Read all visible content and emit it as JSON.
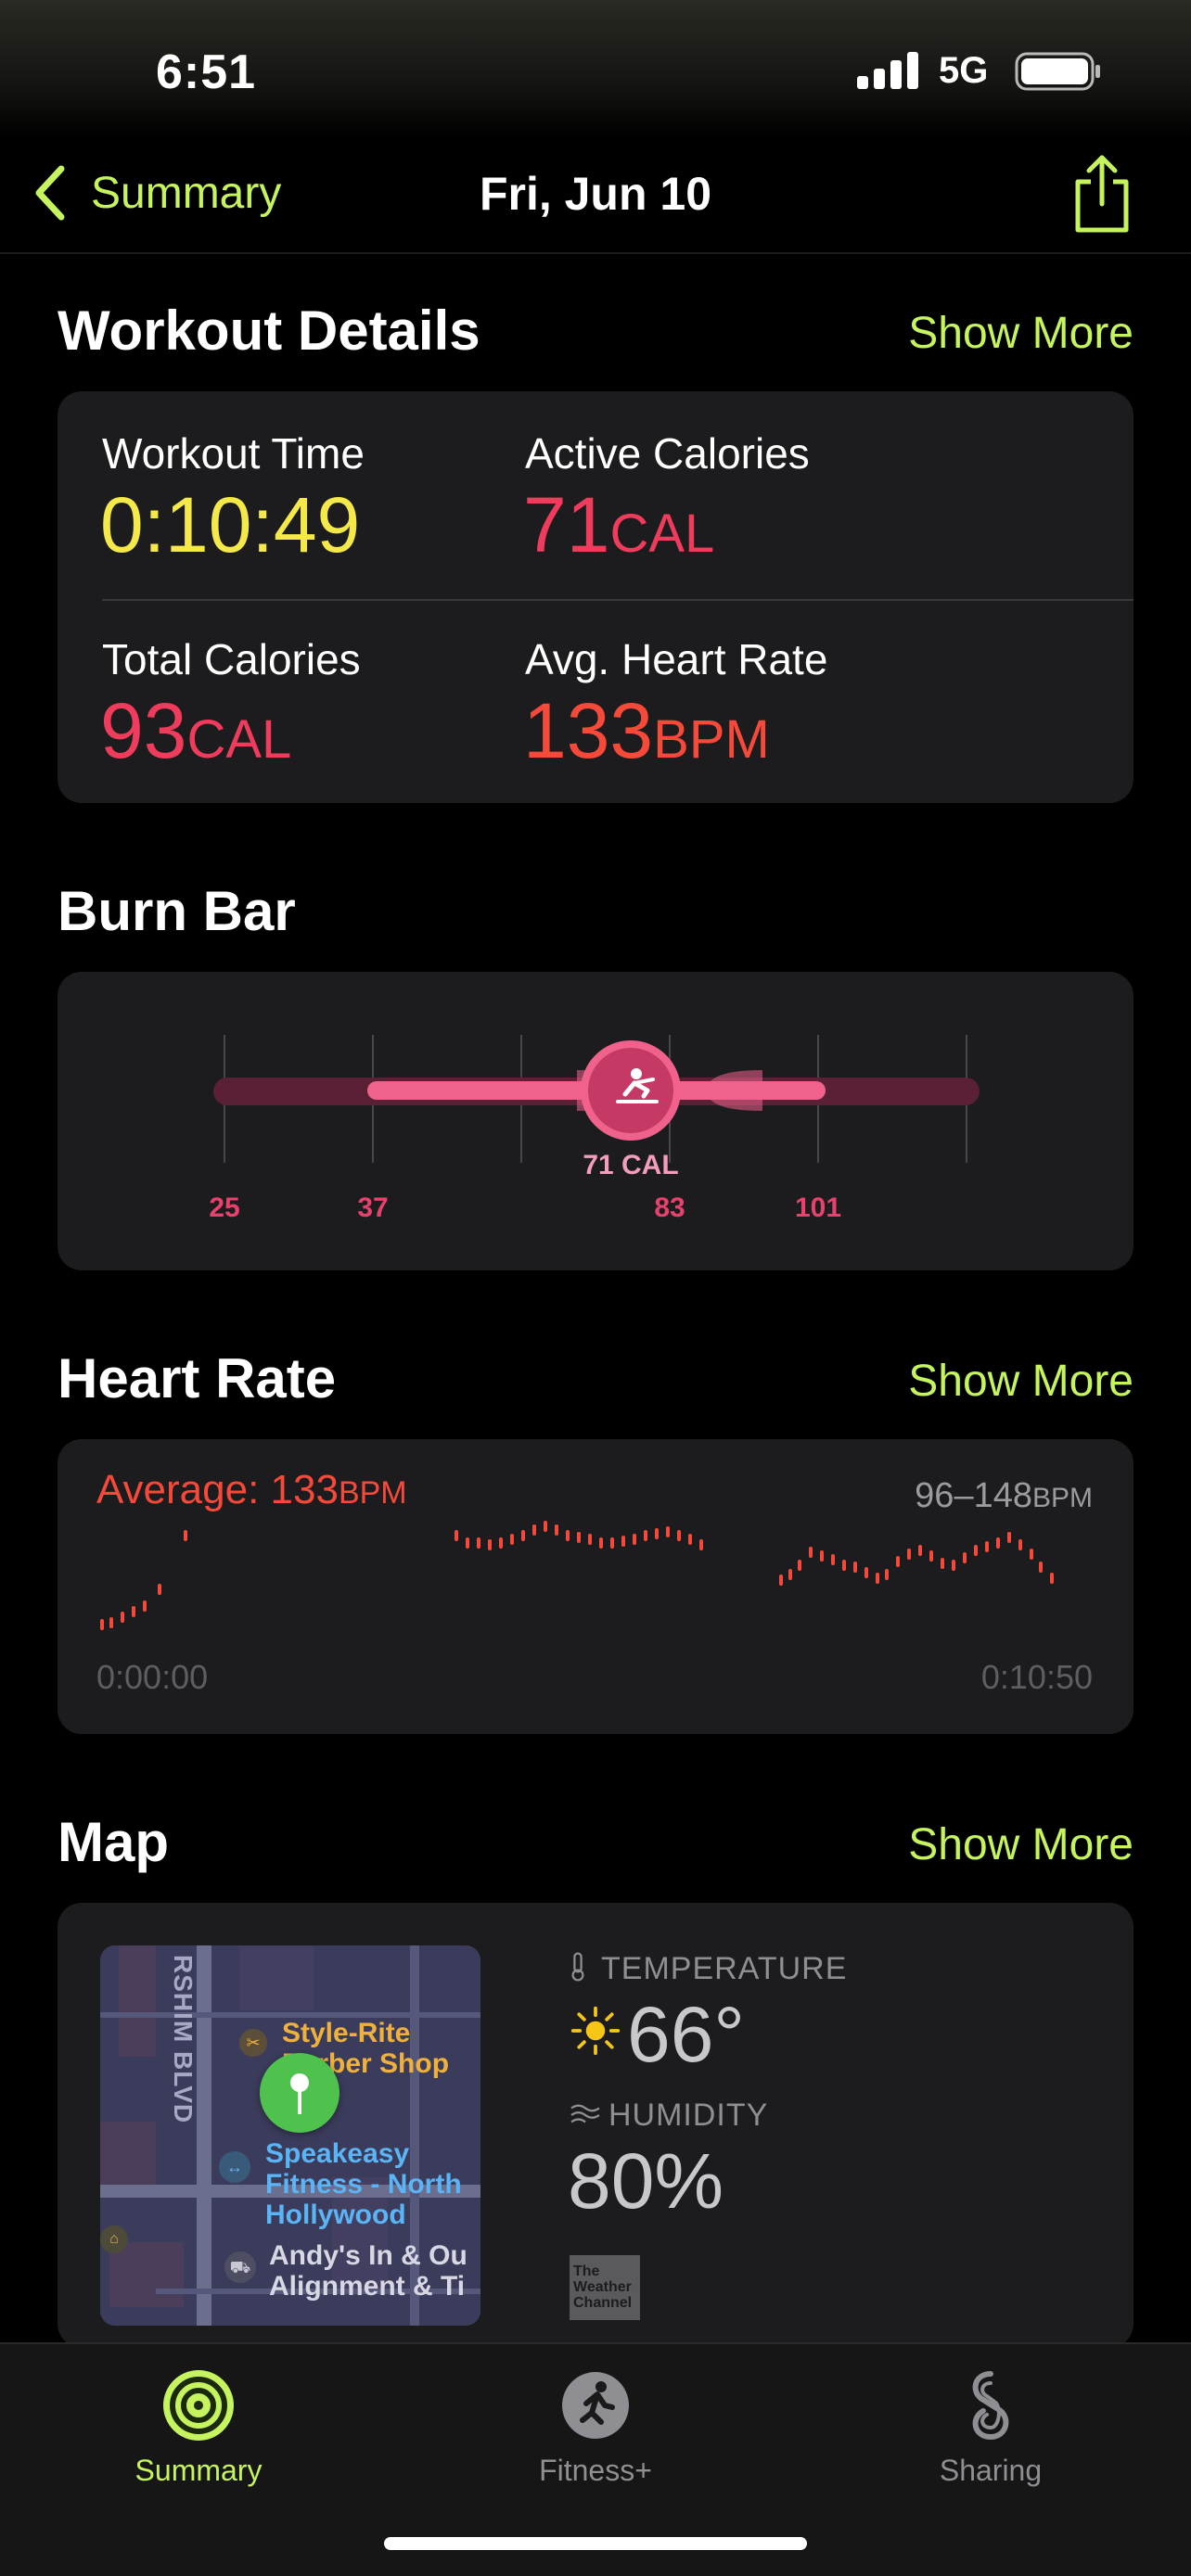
{
  "status_bar": {
    "time": "6:51",
    "network": "5G"
  },
  "nav": {
    "back_label": "Summary",
    "title": "Fri, Jun 10"
  },
  "workout_details": {
    "title": "Workout Details",
    "show_more": "Show More",
    "metrics": [
      {
        "label": "Workout Time",
        "value": "0:10:49",
        "unit": "",
        "color": "#f5e94a"
      },
      {
        "label": "Active Calories",
        "value": "71",
        "unit": "CAL",
        "color": "#f03c5c"
      },
      {
        "label": "Total Calories",
        "value": "93",
        "unit": "CAL",
        "color": "#f03c5c"
      },
      {
        "label": "Avg. Heart Rate",
        "value": "133",
        "unit": "BPM",
        "color": "#f5493a"
      }
    ]
  },
  "burn_bar": {
    "title": "Burn Bar",
    "marker_label": "71 CAL",
    "marker_icon": "rowing-icon",
    "ticks": [
      "25",
      "37",
      "83",
      "101"
    ]
  },
  "heart_rate": {
    "title": "Heart Rate",
    "show_more": "Show More",
    "average_label": "Average: 133",
    "average_unit": "BPM",
    "range_label": "96–148",
    "range_unit": "BPM",
    "start_time": "0:00:00",
    "end_time": "0:10:50",
    "color": "#f5493a"
  },
  "map": {
    "title": "Map",
    "show_more": "Show More",
    "street_label": "RSHIM BLVD",
    "places": [
      "Style-Rite Barber Shop",
      "Speakeasy Fitness - North Hollywood",
      "Andy's In & Ou Alignment & Ti"
    ],
    "temperature_label": "TEMPERATURE",
    "temperature_value": "66°",
    "humidity_label": "HUMIDITY",
    "humidity_value": "80%",
    "weather_logo": "The Weather Channel"
  },
  "tab_bar": {
    "tabs": [
      {
        "label": "Summary",
        "icon": "activity-rings-icon",
        "active": true
      },
      {
        "label": "Fitness+",
        "icon": "fitness-plus-icon",
        "active": false
      },
      {
        "label": "Sharing",
        "icon": "sharing-icon",
        "active": false
      }
    ]
  },
  "colors": {
    "accent": "#c6f45e",
    "burn_pink": "#f0628c"
  }
}
